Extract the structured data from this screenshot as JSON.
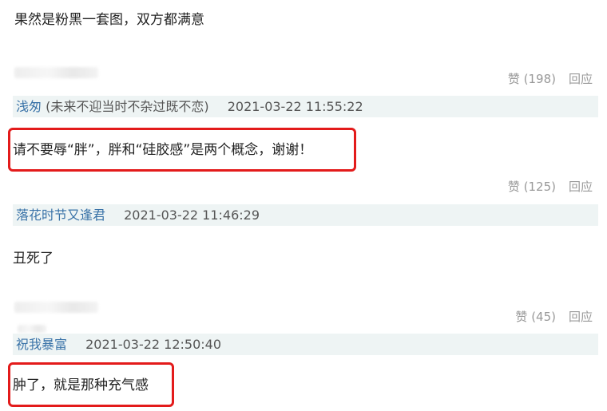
{
  "top_comment": {
    "text": "果然是粉黑一套图，双方都满意"
  },
  "comments": [
    {
      "like_label": "赞 (198)",
      "reply_label": "回应",
      "username": "浅匆",
      "username_suffix": "(未来不迎当时不杂过既不恋)",
      "timestamp": "2021-03-22 11:55:22",
      "content": "请不要辱“胖”，胖和“硅胶感”是两个概念，谢谢！",
      "highlighted": true
    },
    {
      "like_label": "赞 (125)",
      "reply_label": "回应",
      "username": "落花时节又逢君",
      "username_suffix": "",
      "timestamp": "2021-03-22 11:46:29",
      "content": "丑死了",
      "highlighted": false
    },
    {
      "like_label": "赞 (45)",
      "reply_label": "回应",
      "username": "祝我暴富",
      "username_suffix": "",
      "timestamp": "2021-03-22 12:50:40",
      "content": "肿了，就是那种充气感",
      "highlighted": true
    }
  ],
  "colors": {
    "username": "#3a73a8",
    "user_bar_bg": "#eef4f4",
    "highlight_border": "#e31b1b",
    "meta_text": "#999999"
  }
}
